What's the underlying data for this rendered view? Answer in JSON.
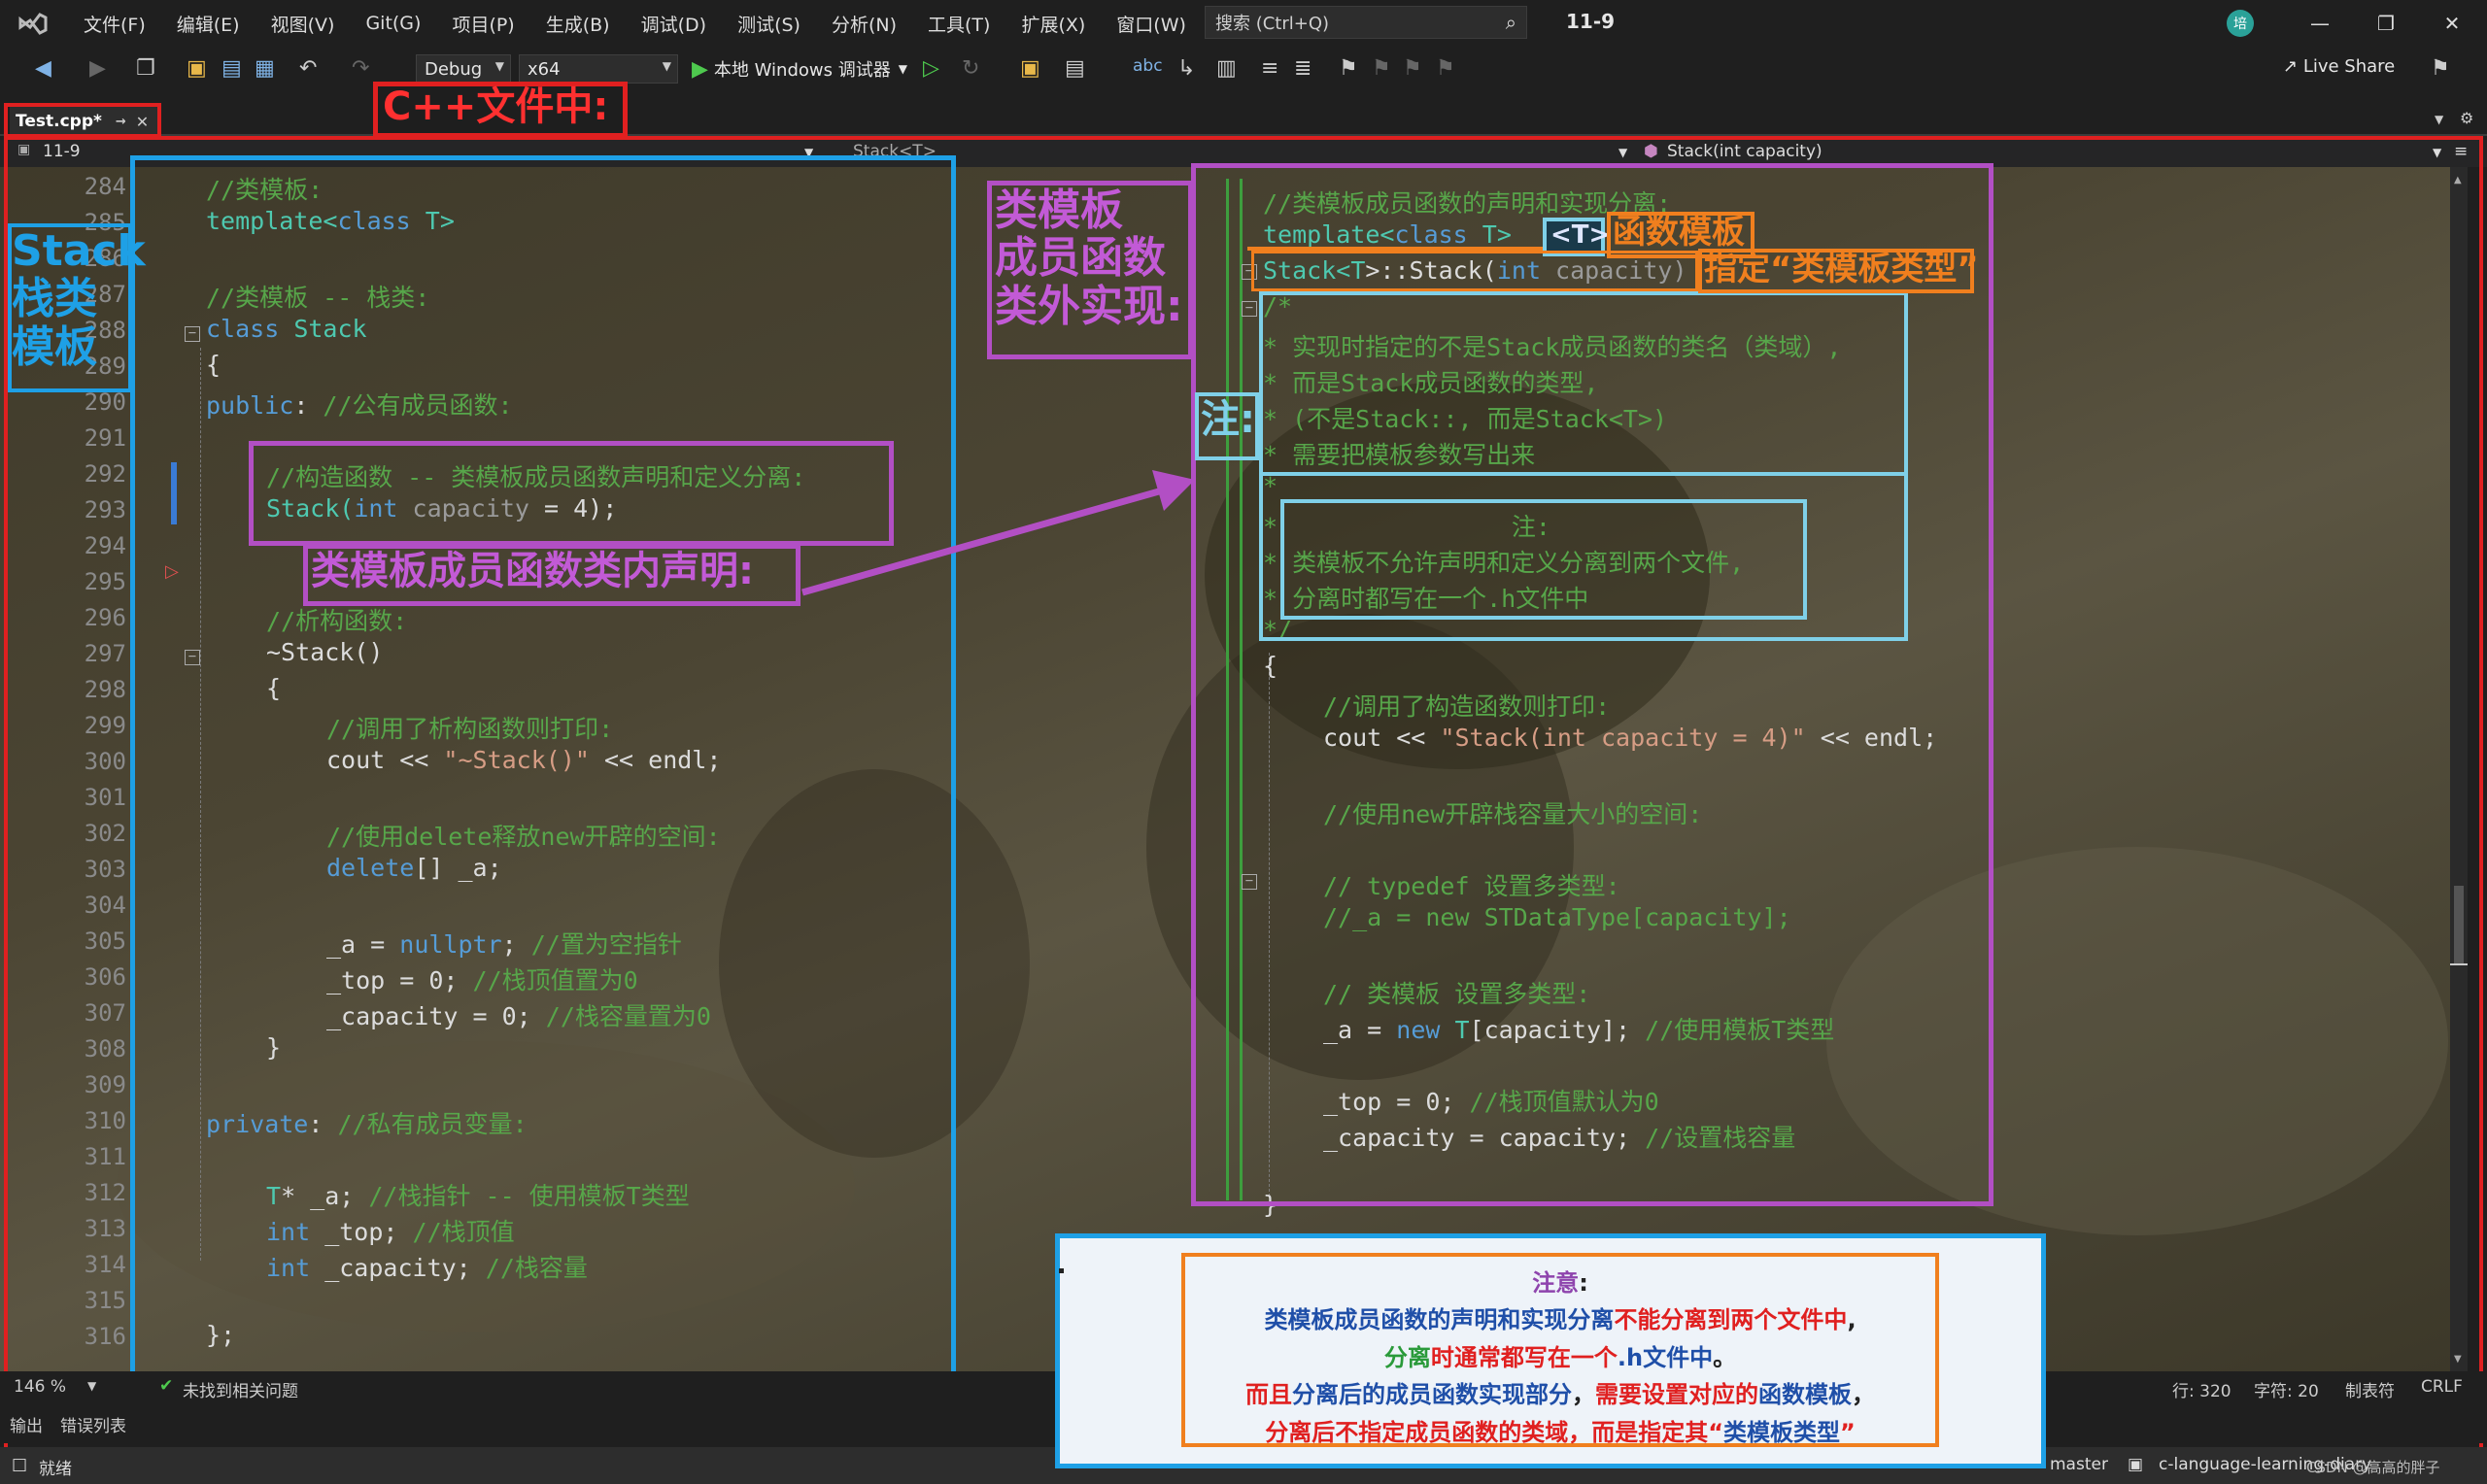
{
  "menubar": {
    "items": [
      "文件(F)",
      "编辑(E)",
      "视图(V)",
      "Git(G)",
      "项目(P)",
      "生成(B)",
      "调试(D)",
      "测试(S)",
      "分析(N)",
      "工具(T)",
      "扩展(X)",
      "窗口(W)",
      "帮助(H)"
    ],
    "search_placeholder": "搜索 (Ctrl+Q)",
    "solution_name": "11-9",
    "avatar": "培"
  },
  "toolbar": {
    "config": "Debug",
    "platform": "x64",
    "run_label": "本地 Windows 调试器",
    "live_share": "Live Share"
  },
  "tab": {
    "name": "Test.cpp*"
  },
  "navbar": {
    "project": "11-9",
    "scope": "Stack<T>",
    "member": "Stack(int capacity)"
  },
  "editor": {
    "line_numbers": [
      "284",
      "285",
      "286",
      "287",
      "288",
      "289",
      "290",
      "291",
      "292",
      "293",
      "294",
      "295",
      "296",
      "297",
      "298",
      "299",
      "300",
      "301",
      "302",
      "303",
      "304",
      "305",
      "306",
      "307",
      "308",
      "309",
      "310",
      "311",
      "312",
      "313",
      "314",
      "315",
      "316"
    ],
    "left_code": {
      "l284": "//类模板:",
      "l285a": "template<",
      "l285b": "class",
      "l285c": " T>",
      "l287": "//类模板 -- 栈类:",
      "l288a": "class",
      "l288b": " Stack",
      "l289": "{",
      "l290a": "public",
      "l290b": ": ",
      "l290c": "//公有成员函数:",
      "l292": "//构造函数 -- 类模板成员函数声明和定义分离:",
      "l293a": "Stack(",
      "l293b": "int",
      "l293c": " capacity",
      "l293d": " = 4);",
      "l296": "//析构函数:",
      "l297": "~Stack()",
      "l298": "{",
      "l299": "//调用了析构函数则打印:",
      "l300a": "cout << ",
      "l300b": "\"~Stack()\"",
      "l300c": " << endl;",
      "l302": "//使用delete释放new开辟的空间:",
      "l303a": "delete",
      "l303b": "[] _a;",
      "l305a": "_a = ",
      "l305b": "nullptr",
      "l305c": "; ",
      "l305d": "//置为空指针",
      "l306a": "_top = 0; ",
      "l306b": "//栈顶值置为0",
      "l307a": "_capacity = 0; ",
      "l307b": "//栈容量置为0",
      "l308": "}",
      "l310a": "private",
      "l310b": ": ",
      "l310c": "//私有成员变量:",
      "l312a": "T",
      "l312b": "* _a; ",
      "l312c": "//栈指针 -- 使用模板T类型",
      "l313a": "int",
      "l313b": " _top; ",
      "l313c": "//栈顶值",
      "l314a": "int",
      "l314b": " _capacity; ",
      "l314c": "//栈容量",
      "l316": "};"
    },
    "right_code": {
      "r1": "//类模板成员函数的声明和实现分离:",
      "r2a": "template<",
      "r2b": "class",
      "r2c": " T>",
      "r3a": "Stack<",
      "r3b": "T",
      "r3c": ">::Stack(",
      "r3d": "int",
      "r3e": " capacity)",
      "r4": "/*",
      "r5": "* 实现时指定的不是Stack成员函数的类名（类域）,",
      "r6": "* 而是Stack成员函数的类型,",
      "r7": "* (不是Stack::, 而是Stack<T>)",
      "r8": "* 需要把模板参数写出来",
      "r9": "*",
      "r10": "*                注:",
      "r11": "* 类模板不允许声明和定义分离到两个文件,",
      "r12": "* 分离时都写在一个.h文件中",
      "r13": "*/",
      "r14": "{",
      "r15": "//调用了构造函数则打印:",
      "r16a": "cout << ",
      "r16b": "\"Stack(int capacity = 4)\"",
      "r16c": " << endl;",
      "r17": "//使用new开辟栈容量大小的空间:",
      "r18": "// typedef 设置多类型:",
      "r19": "//_a = new STDataType[capacity];",
      "r20": "// 类模板 设置多类型:",
      "r21a": "_a = ",
      "r21b": "new",
      "r21c": " T",
      "r21d": "[capacity]; ",
      "r21e": "//使用模板T类型",
      "r22a": "_top = 0; ",
      "r22b": "//栈顶值默认为0",
      "r23a": "_capacity = capacity; ",
      "r23b": "//设置栈容量",
      "r24": "}"
    }
  },
  "annotations": {
    "cpp_file": "C++文件中:",
    "stack_template": "Stack\n栈类\n模板",
    "inclass_decl": "类模板成员函数类内声明:",
    "outclass_impl": "类模板\n成员函数\n类外实现:",
    "note_short": "注:",
    "func_template": "函数模板",
    "t_tag": "<T>",
    "specify_type": "指定“类模板类型”"
  },
  "note": {
    "title": "注意",
    "title_colon": ":",
    "line1a": "类模板成员函数的声明和实现分离",
    "line1b": "不能分离到两个文件中",
    "line1c": ",",
    "line2a": "分离",
    "line2b": "时通常都写在一个",
    "line2c": ".h文件中",
    "line2d": "。",
    "line3a": "而且",
    "line3b": "分离后的成员函数实现部分",
    "line3c": "，",
    "line3d": "需要设置对应的",
    "line3e": "函数模板",
    "line3f": "，",
    "line4a": "分离后不指定成员函数的类域",
    "line4b": "，而是指定其“",
    "line4c": "类模板类型",
    "line4d": "”"
  },
  "status": {
    "zoom": "146 %",
    "issues": "未找到相关问题",
    "line": "行: 320",
    "col": "字符: 20",
    "tabs": "制表符",
    "eol": "CRLF",
    "output_tab": "输出",
    "errors_tab": "错误列表",
    "ready": "就绪",
    "branch": "master",
    "repo": "c-language-learning-diary",
    "watermark": "CSDN @高高的胖子"
  },
  "colors": {
    "red_box": "#e02020",
    "blue_box": "#1ea0e6",
    "purple_box": "#b24fc4",
    "cyan_box": "#7fd0e8",
    "orange_box": "#f07f1e"
  }
}
